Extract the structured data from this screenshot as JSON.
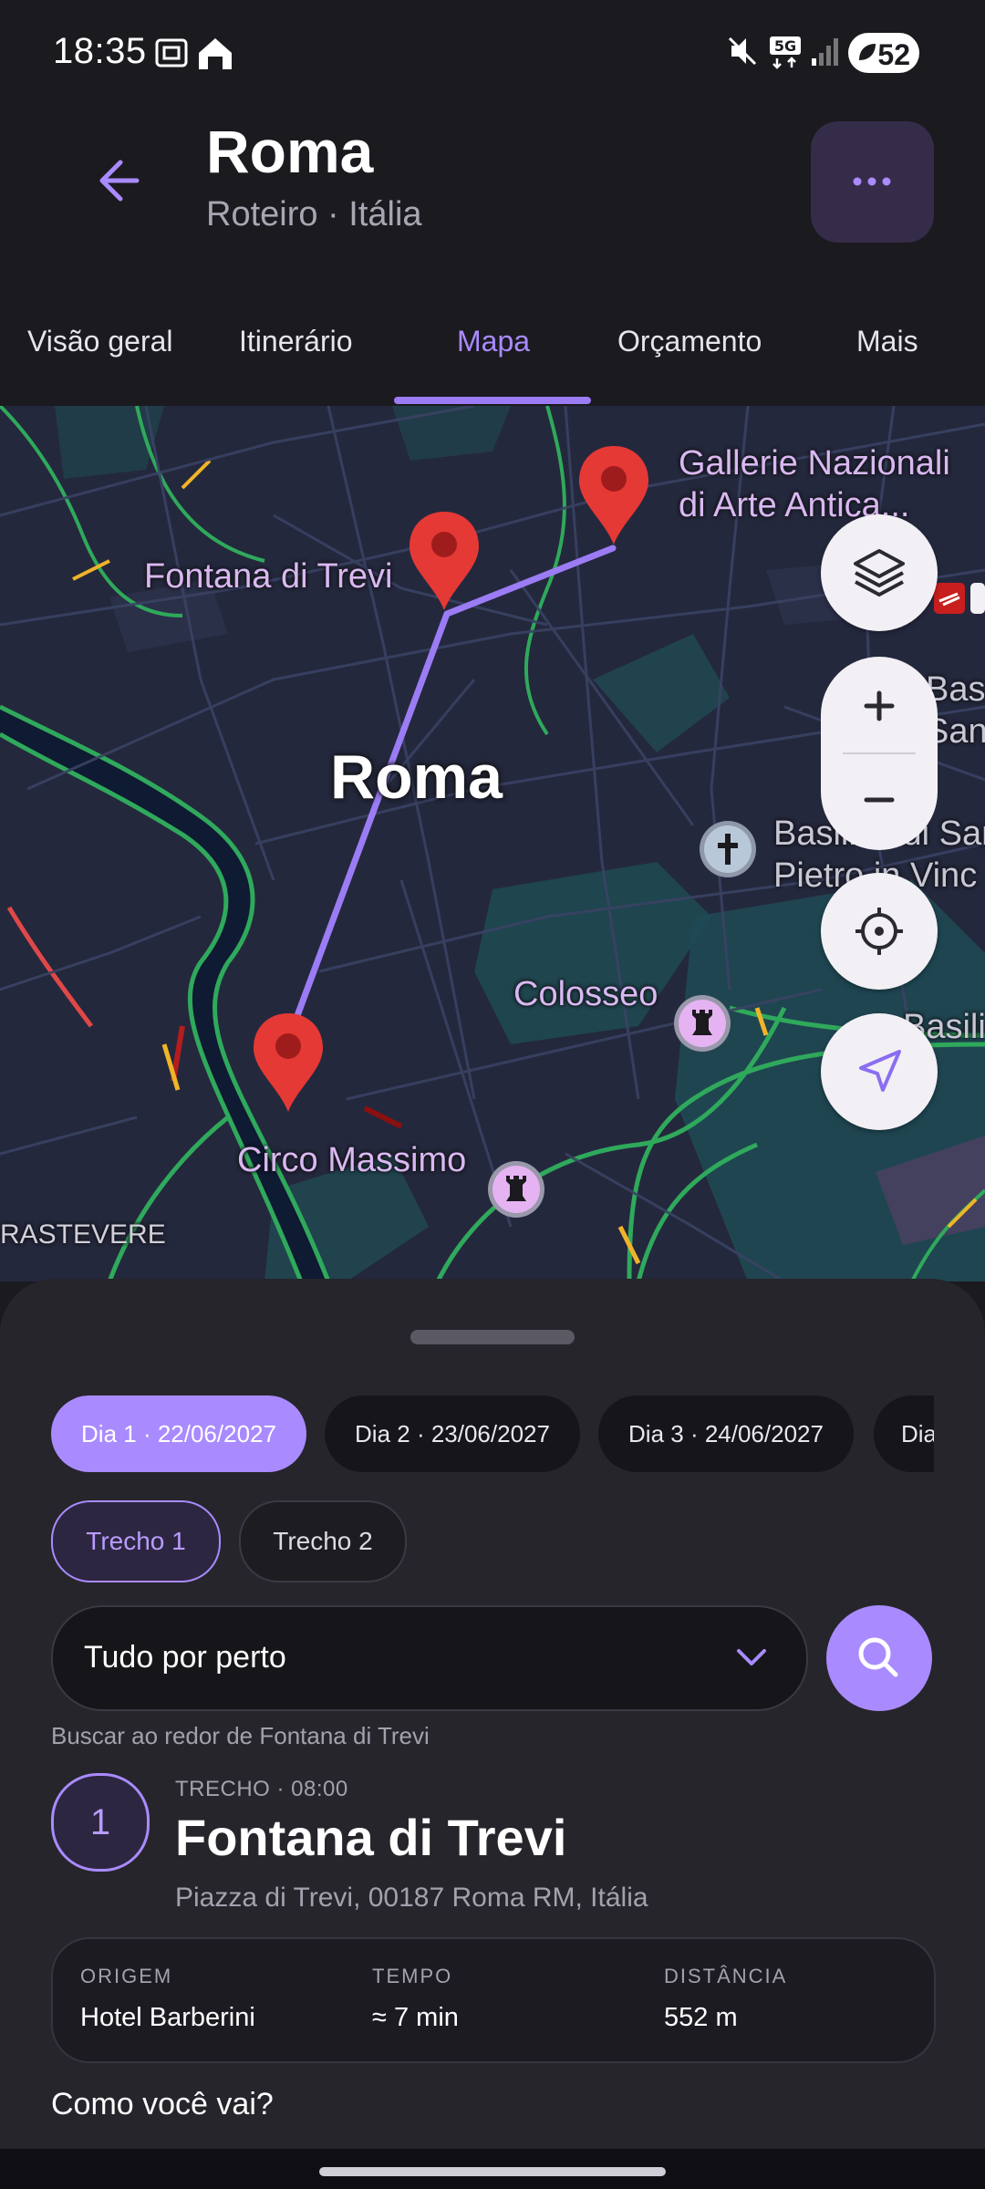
{
  "status_bar": {
    "time": "18:35",
    "battery": "52"
  },
  "header": {
    "title": "Roma",
    "subtitle": "Roteiro · Itália"
  },
  "tabs": [
    {
      "label": "Visão geral"
    },
    {
      "label": "Itinerário"
    },
    {
      "label": "Mapa"
    },
    {
      "label": "Orçamento"
    },
    {
      "label": "Mais"
    }
  ],
  "map": {
    "city_label": "Roma",
    "places": {
      "gallerie_line1": "Gallerie Nazionali",
      "gallerie_line2": "di Arte Antica...",
      "fontana": "Fontana di Trevi",
      "colosseo": "Colosseo",
      "circo": "Circo Massimo",
      "basilica_line1": "Basilica di San",
      "basilica_line2": "Pietro in Vinc",
      "bas_line1": "Bas",
      "bas_line2": "San",
      "basili": "Basili",
      "trastevere": "RASTEVERE"
    }
  },
  "days": [
    {
      "label": "Dia 1 · 22/06/2027"
    },
    {
      "label": "Dia 2 · 23/06/2027"
    },
    {
      "label": "Dia 3 · 24/06/2027"
    },
    {
      "label": "Dia"
    }
  ],
  "segments": [
    {
      "label": "Trecho 1"
    },
    {
      "label": "Trecho 2"
    }
  ],
  "filter": {
    "value": "Tudo por perto",
    "hint": "Buscar ao redor de Fontana di Trevi"
  },
  "step": {
    "number": "1",
    "meta": "TRECHO · 08:00",
    "title": "Fontana di Trevi",
    "address": "Piazza di Trevi, 00187 Roma RM, Itália"
  },
  "info": {
    "origin_label": "ORIGEM",
    "origin_value": "Hotel Barberini",
    "time_label": "TEMPO",
    "time_value": "≈ 7 min",
    "distance_label": "DISTÂNCIA",
    "distance_value": "552 m"
  },
  "how_title": "Como você vai?",
  "colors": {
    "accent": "#a98bff",
    "marker": "#e53935",
    "map_bg": "#24283d"
  }
}
